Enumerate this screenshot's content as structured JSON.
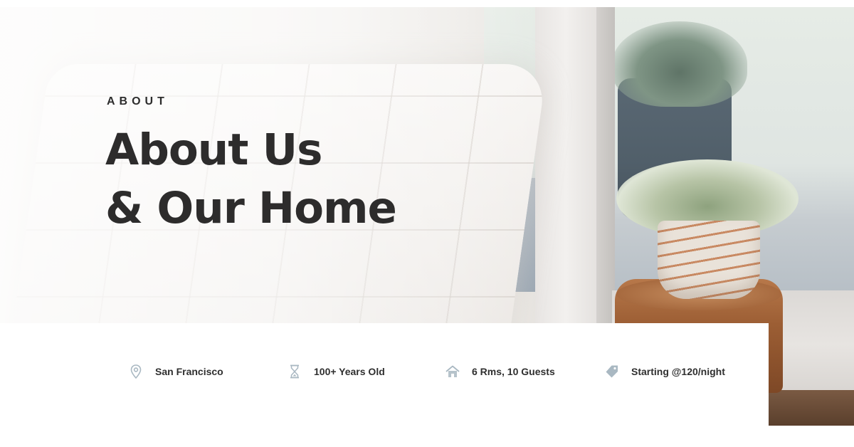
{
  "hero": {
    "eyebrow": "ABOUT",
    "headline_line1": "About Us",
    "headline_line2": "& Our Home"
  },
  "info": {
    "items": [
      {
        "icon": "location-pin-icon",
        "label": "San Francisco"
      },
      {
        "icon": "hourglass-icon",
        "label": "100+ Years Old"
      },
      {
        "icon": "house-icon",
        "label": "6 Rms, 10 Guests"
      },
      {
        "icon": "price-tag-icon",
        "label": "Starting @120/night"
      }
    ]
  },
  "colors": {
    "heading": "#2d2c2c",
    "icon": "#a9b8c2",
    "card_background": "#ffffff"
  }
}
